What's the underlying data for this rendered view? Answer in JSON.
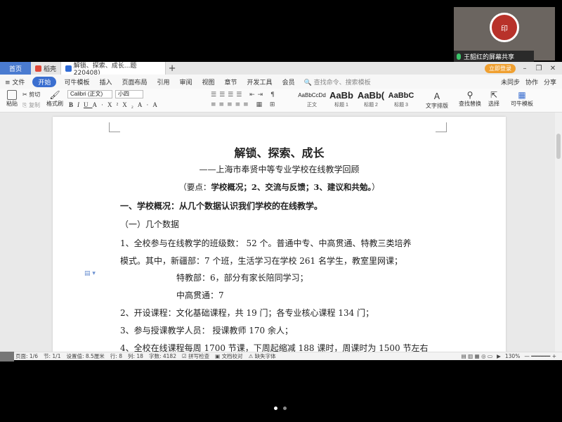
{
  "tabbar": {
    "home": "首页",
    "tab1": "稻壳",
    "tab2": "解锁、探索、成长...题220408)",
    "login": "立即登录"
  },
  "menu": {
    "file": "文件",
    "items": [
      "开始",
      "可牛模板",
      "插入",
      "页面布局",
      "引用",
      "审阅",
      "视图",
      "章节",
      "开发工具",
      "会员"
    ],
    "search": "查找命令、搜索模板",
    "right": [
      "未同步",
      "协作",
      "分享"
    ]
  },
  "ribbon": {
    "paste": "粘贴",
    "cut": "剪切",
    "copy": "复制",
    "format_painter": "格式刷",
    "font_name": "Calibri (正文)",
    "font_size": "小四",
    "styles": [
      {
        "sample": "AaBbCcDd",
        "label": "正文"
      },
      {
        "sample": "AaBb",
        "label": "标题 1"
      },
      {
        "sample": "AaBb(",
        "label": "标题 2"
      },
      {
        "sample": "AaBbC",
        "label": "标题 3"
      }
    ],
    "text_layout": "文字排版",
    "find_replace": "查找替换",
    "select": "选择",
    "template": "可牛模板"
  },
  "document": {
    "title": "解锁、探索、成长",
    "subtitle": "——上海市奉贤中等专业学校在线教学回顾",
    "keypoints_prefix": "（要点：",
    "keypoints_body": "学校概况；2、交流与反馈；3、建议和共勉。",
    "keypoints_suffix": "）",
    "h1": "一、学校概况：从几个数据认识我们学校的在线教学。",
    "h2": "（一）几个数据",
    "p1": "1、全校参与在线教学的班级数：  52 个。普通中专、中高贯通、特教三类培养",
    "p2": "模式。其中，新疆部：7 个班，生活学习在学校 261 名学生，教室里网课；",
    "p3": "特教部：6，部分有家长陪同学习；",
    "p4": "中高贯通：7",
    "p5": "2、开设课程：文化基础课程，共 19 门；各专业核心课程 134 门；",
    "p6": "3、参与授课教学人员：  授课教师 170 余人；",
    "p7": "4、全校在线课程每周 1700 节课，下周起缩减 188 课时，周课时为 1500 节左右"
  },
  "status": {
    "page": "页面: 1/6",
    "section": "节: 1/1",
    "setting": "设置值: 8.5厘米",
    "row": "行: 8",
    "col": "列: 18",
    "words": "字数: 4182",
    "spell": "拼写检查",
    "proof": "文档校对",
    "missing_font": "缺失字体",
    "zoom": "130%"
  },
  "share": {
    "label": "王韶红的屏幕共享",
    "seal_text": "印"
  }
}
